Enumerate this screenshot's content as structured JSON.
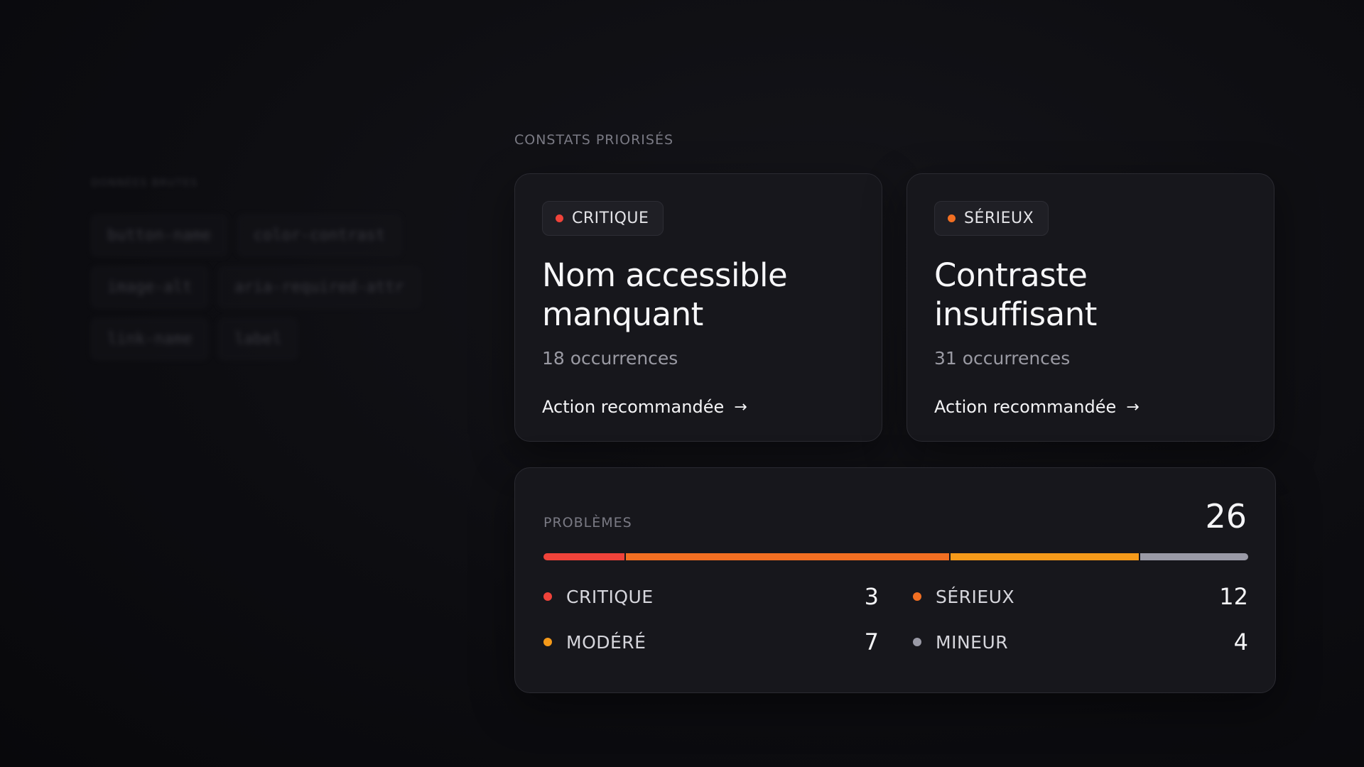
{
  "sidebar": {
    "title": "DONNÉES BRUTES",
    "chips": [
      "button-name",
      "color-contrast",
      "image-alt",
      "aria-required-attr",
      "link-name",
      "label"
    ]
  },
  "section_label": "CONSTATS PRIORISÉS",
  "findings": [
    {
      "severity": "CRITIQUE",
      "severity_color": "#f0433a",
      "title": "Nom accessible manquant",
      "occurrences": "18 occurrences",
      "action": "Action recommandée",
      "arrow": "→"
    },
    {
      "severity": "SÉRIEUX",
      "severity_color": "#f26f22",
      "title": "Contraste insuffisant",
      "occurrences": "31 occurrences",
      "action": "Action recommandée",
      "arrow": "→"
    }
  ],
  "problems": {
    "label": "PROBLÈMES",
    "total": "26",
    "breakdown": [
      {
        "label": "CRITIQUE",
        "value": 3,
        "color": "#f0433a"
      },
      {
        "label": "SÉRIEUX",
        "value": 12,
        "color": "#f26f22"
      },
      {
        "label": "MODÉRÉ",
        "value": 7,
        "color": "#f59a1a"
      },
      {
        "label": "MINEUR",
        "value": 4,
        "color": "#9a9aa6"
      }
    ]
  }
}
